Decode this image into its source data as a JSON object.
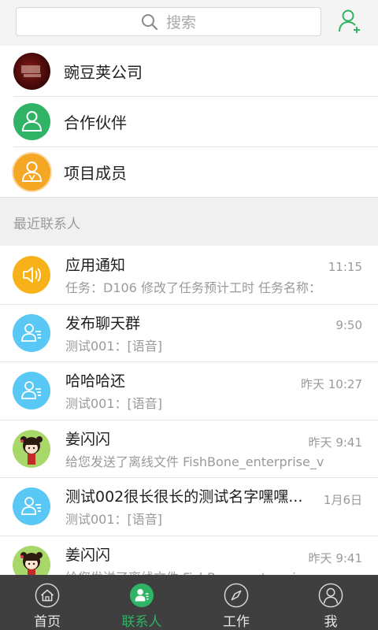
{
  "search": {
    "placeholder": "搜索"
  },
  "groups": [
    {
      "label": "豌豆荚公司"
    },
    {
      "label": "合作伙伴"
    },
    {
      "label": "项目成员"
    }
  ],
  "recent_section_title": "最近联系人",
  "recent": [
    {
      "name": "应用通知",
      "message": "任务：D106 修改了任务预计工时 任务名称：",
      "time": "11:15",
      "avatar": "speaker-icon"
    },
    {
      "name": "发布聊天群",
      "message": "测试001：[语音]",
      "time": "9:50",
      "avatar": "group-chat-icon"
    },
    {
      "name": "哈哈哈还",
      "message": "测试001：[语音]",
      "time": "昨天 10:27",
      "avatar": "group-chat-icon"
    },
    {
      "name": "姜闪闪",
      "message": "给您发送了离线文件 FishBone_enterprise_v",
      "time": "昨天 9:41",
      "avatar": "cartoon-girl-avatar"
    },
    {
      "name": "测试002很长很长的测试名字嘿嘿...",
      "message": "测试001：[语音]",
      "time": "1月6日",
      "avatar": "group-chat-icon"
    },
    {
      "name": "姜闪闪",
      "message": "给您发送了离线文件 FishBone_enterprise_v",
      "time": "昨天 9:41",
      "avatar": "cartoon-girl-avatar"
    }
  ],
  "tabs": [
    {
      "label": "首页",
      "icon": "home-icon",
      "active": false
    },
    {
      "label": "联系人",
      "icon": "contacts-icon",
      "active": true
    },
    {
      "label": "工作",
      "icon": "compass-icon",
      "active": false
    },
    {
      "label": "我",
      "icon": "profile-icon",
      "active": false
    }
  ],
  "colors": {
    "accent_green": "#2fb364",
    "orange": "#f5a623",
    "notify_yellow": "#f7b21a",
    "chat_blue": "#5ac8f5",
    "tabbar": "#3f3f3f"
  }
}
